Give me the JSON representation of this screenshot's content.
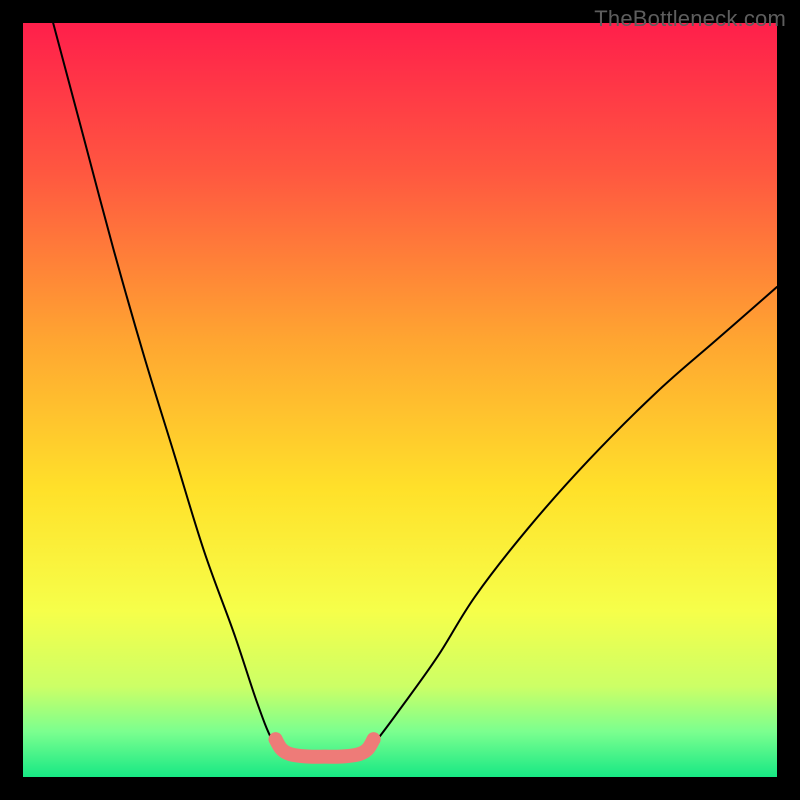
{
  "watermark": "TheBottleneck.com",
  "chart_data": {
    "type": "line",
    "title": "",
    "xlabel": "",
    "ylabel": "",
    "xlim": [
      0,
      100
    ],
    "ylim": [
      0,
      100
    ],
    "grid": false,
    "legend": false,
    "series": [
      {
        "name": "curve-left",
        "x": [
          4,
          8,
          12,
          16,
          20,
          24,
          28,
          31,
          33,
          34.5
        ],
        "values": [
          100,
          85,
          70,
          56,
          43,
          30,
          19,
          10,
          5,
          3.5
        ],
        "style": "black-thin"
      },
      {
        "name": "curve-right",
        "x": [
          45.5,
          47,
          50,
          55,
          60,
          67,
          75,
          84,
          92,
          100
        ],
        "values": [
          3.5,
          5,
          9,
          16,
          24,
          33,
          42,
          51,
          58,
          65
        ],
        "style": "black-thin"
      },
      {
        "name": "trough-highlight",
        "x": [
          33.5,
          34.2,
          35,
          36,
          38,
          40,
          42,
          44,
          45,
          45.8,
          46.5
        ],
        "values": [
          5,
          3.8,
          3.2,
          2.9,
          2.7,
          2.7,
          2.7,
          2.9,
          3.2,
          3.8,
          5
        ],
        "style": "salmon-thick"
      }
    ],
    "background_gradient": {
      "stops": [
        {
          "offset": 0.0,
          "color": "#ff1f4b"
        },
        {
          "offset": 0.2,
          "color": "#ff5840"
        },
        {
          "offset": 0.42,
          "color": "#ffa531"
        },
        {
          "offset": 0.62,
          "color": "#ffe12a"
        },
        {
          "offset": 0.78,
          "color": "#f6ff4a"
        },
        {
          "offset": 0.88,
          "color": "#ccff66"
        },
        {
          "offset": 0.94,
          "color": "#7bff8f"
        },
        {
          "offset": 1.0,
          "color": "#17e884"
        }
      ]
    },
    "stroke_styles": {
      "black-thin": {
        "stroke": "#000000",
        "width": 2,
        "linecap": "round"
      },
      "salmon-thick": {
        "stroke": "#ee7b78",
        "width": 14,
        "linecap": "round"
      },
      "salmon-dot": {
        "fill": "#ee7b78",
        "r": 7
      }
    }
  }
}
